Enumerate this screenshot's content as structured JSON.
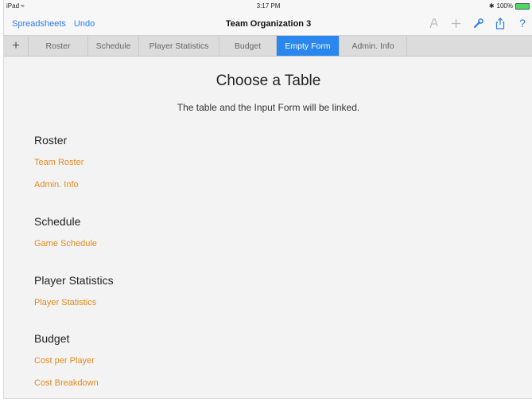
{
  "status_bar": {
    "device": "iPad",
    "wifi_icon": "wifi-icon",
    "time": "3:17 PM",
    "bluetooth_icon": "bluetooth-icon",
    "battery": "100%"
  },
  "toolbar": {
    "spreadsheets_label": "Spreadsheets",
    "undo_label": "Undo",
    "title": "Team Organization 3",
    "tools": [
      "format-brush-icon",
      "add-icon",
      "wrench-icon",
      "share-icon",
      "help-icon"
    ]
  },
  "tabs": {
    "add_icon": "plus-icon",
    "items": [
      {
        "label": "Roster"
      },
      {
        "label": "Schedule"
      },
      {
        "label": "Player Statistics"
      },
      {
        "label": "Budget"
      },
      {
        "label": "Empty Form",
        "active": true
      },
      {
        "label": "Admin. Info"
      }
    ]
  },
  "main": {
    "title": "Choose a Table",
    "subtitle": "The table and the Input Form will be linked.",
    "sections": [
      {
        "title": "Roster",
        "items": [
          "Team Roster",
          "Admin. Info"
        ]
      },
      {
        "title": "Schedule",
        "items": [
          "Game Schedule"
        ]
      },
      {
        "title": "Player Statistics",
        "items": [
          "Player Statistics"
        ]
      },
      {
        "title": "Budget",
        "items": [
          "Cost per Player",
          "Cost Breakdown"
        ]
      }
    ]
  },
  "colors": {
    "accent_blue": "#2b87f0",
    "link_orange": "#e08a1e",
    "background": "#f3f3f3"
  }
}
